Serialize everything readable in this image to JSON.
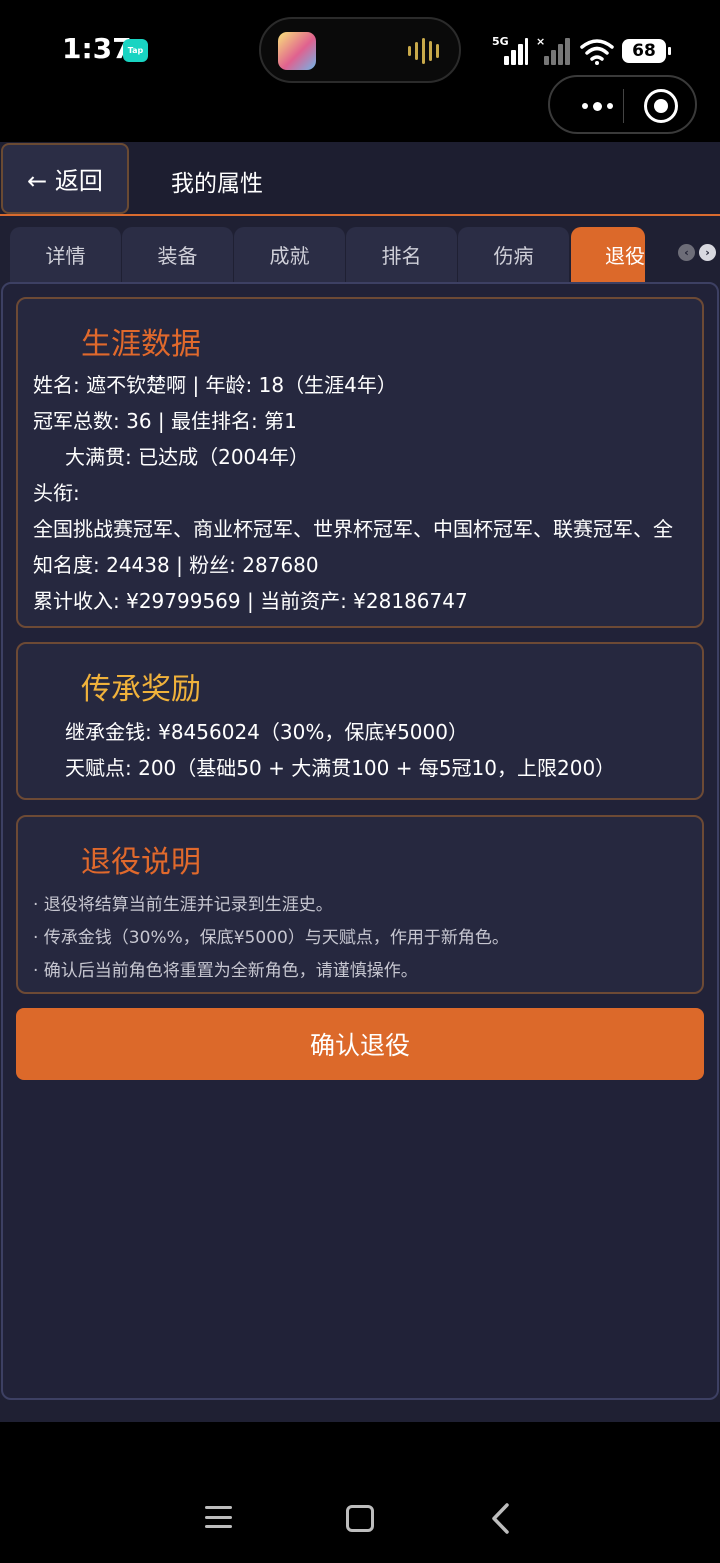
{
  "status": {
    "time": "1:37",
    "tap_badge": "Tap",
    "network": "5G",
    "battery": "68"
  },
  "header": {
    "back_label": "← 返回",
    "title": "我的属性"
  },
  "tabs": [
    {
      "label": "详情",
      "active": false
    },
    {
      "label": "装备",
      "active": false
    },
    {
      "label": "成就",
      "active": false
    },
    {
      "label": "排名",
      "active": false
    },
    {
      "label": "伤病",
      "active": false
    },
    {
      "label": "退役",
      "active": true
    }
  ],
  "career": {
    "title": "生涯数据",
    "line1": "姓名: 遮不钦楚啊 | 年龄: 18（生涯4年）",
    "line2": "冠军总数: 36 | 最佳排名: 第1",
    "line3": "大满贯: 已达成（2004年）",
    "line4": "头衔:",
    "line5": "全国挑战赛冠军、商业杯冠军、世界杯冠军、中国杯冠军、联赛冠军、全",
    "line6": "知名度: 24438 | 粉丝: 287680",
    "line7": "累计收入: ¥29799569 | 当前资产: ¥28186747"
  },
  "inherit": {
    "title": "传承奖励",
    "line1": "继承金钱: ¥8456024（30%，保底¥5000）",
    "line2": "天赋点: 200（基础50 + 大满贯100 + 每5冠10，上限200）"
  },
  "notes": {
    "title": "退役说明",
    "line1": "· 退役将结算当前生涯并记录到生涯史。",
    "line2": "· 传承金钱（30%%，保底¥5000）与天赋点，作用于新角色。",
    "line3": "· 确认后当前角色将重置为全新角色，请谨慎操作。"
  },
  "confirm_label": "确认退役",
  "colors": {
    "accent": "#dc692a",
    "gold": "#f0b23b",
    "background": "#1f2033"
  }
}
